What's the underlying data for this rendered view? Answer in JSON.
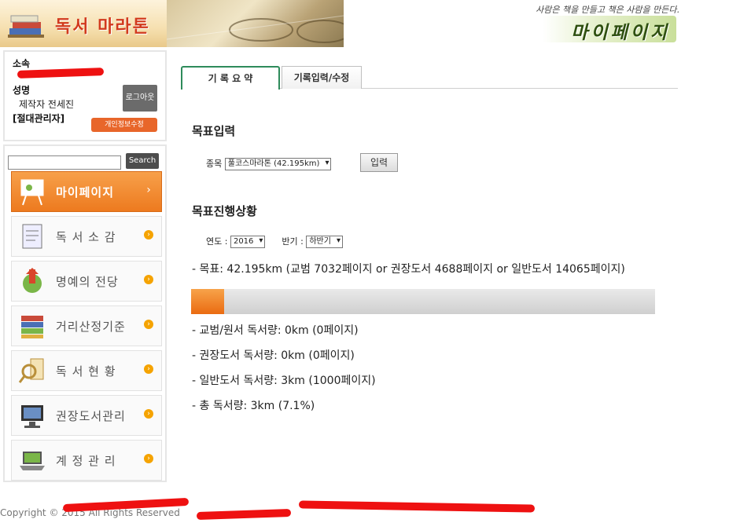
{
  "header": {
    "logo_text": "독서 마라톤",
    "slogan": "사람은 책을 만들고 책은 사람을 만든다.",
    "page_title": "마이페이지"
  },
  "user": {
    "affiliation_label": "소속",
    "name_label": "성명",
    "name_value": "제작자 전세진",
    "role": "[절대관리자]",
    "logout_label": "로그아웃",
    "edit_profile_label": "개인정보수정"
  },
  "sidebar": {
    "search_placeholder": "",
    "search_label": "Search",
    "items": [
      {
        "label": "마이페이지",
        "icon": "easel-icon",
        "active": true
      },
      {
        "label": "독 서 소 감",
        "icon": "clipboard-icon",
        "active": false
      },
      {
        "label": "명예의 전당",
        "icon": "trophy-icon",
        "active": false
      },
      {
        "label": "거리산정기준",
        "icon": "books-icon",
        "active": false
      },
      {
        "label": "독 서 현 황",
        "icon": "magnifier-icon",
        "active": false
      },
      {
        "label": "권장도서관리",
        "icon": "monitor-icon",
        "active": false
      },
      {
        "label": "계 정 관 리",
        "icon": "laptop-icon",
        "active": false
      }
    ]
  },
  "tabs": [
    {
      "label": "기 록 요 약",
      "active": true
    },
    {
      "label": "기록입력/수정",
      "active": false
    }
  ],
  "goal_input": {
    "title": "목표입력",
    "event_label": "종목",
    "event_value": "풀코스마라톤 (42.195km)",
    "submit_label": "입력"
  },
  "goal_progress": {
    "title": "목표진행상황",
    "year_label": "연도 :",
    "year_value": "2016",
    "half_label": "반기 :",
    "half_value": "하반기",
    "goal_text": "- 목표: 42.195km (교범 7032페이지 or 권장도서 4688페이지 or 일반도서 14065페이지)",
    "progress_percent": 7.1,
    "stats": [
      "- 교범/원서 독서량: 0km (0페이지)",
      "- 권장도서 독서량: 0km (0페이지)",
      "- 일반도서 독서량: 3km (1000페이지)",
      "- 총 독서량: 3km (7.1%)"
    ]
  },
  "footer": {
    "text": "Copyright © 2015 All Rights Reserved"
  },
  "colors": {
    "accent_orange": "#ed7a1f",
    "tab_green": "#2e8b5b"
  }
}
